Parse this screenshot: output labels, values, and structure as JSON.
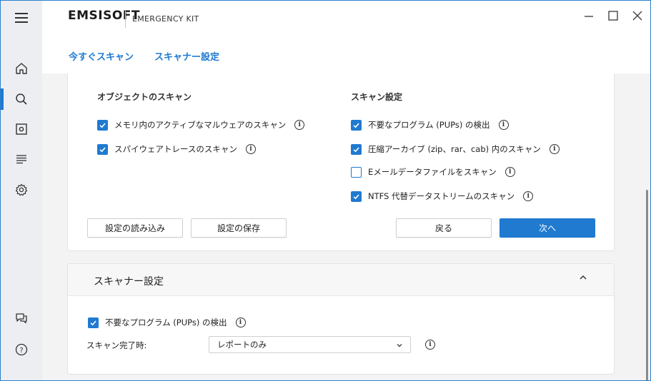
{
  "app": {
    "logo": "EMSISOFT",
    "product": "EMERGENCY KIT"
  },
  "window_controls": {
    "minimize_icon": "minimize-icon",
    "maximize_icon": "maximize-icon",
    "close_icon": "close-icon"
  },
  "sidebar": {
    "items": [
      {
        "icon": "home-icon"
      },
      {
        "icon": "search-icon",
        "active": true
      },
      {
        "icon": "quarantine-icon"
      },
      {
        "icon": "logs-icon"
      },
      {
        "icon": "settings-icon"
      },
      {
        "icon": "chat-icon"
      },
      {
        "icon": "help-icon"
      }
    ]
  },
  "tabs": {
    "scan_now": "今すぐスキャン",
    "scanner_settings": "スキャナー設定"
  },
  "objects_section": {
    "title": "オブジェクトのスキャン",
    "options": [
      {
        "label": "メモリ内のアクティブなマルウェアのスキャン",
        "checked": true
      },
      {
        "label": "スパイウェアトレースのスキャン",
        "checked": true
      }
    ]
  },
  "scan_settings_section": {
    "title": "スキャン設定",
    "options": [
      {
        "label": "不要なプログラム (PUPs) の検出",
        "checked": true
      },
      {
        "label": "圧縮アーカイブ (zip、rar、cab) 内のスキャン",
        "checked": true
      },
      {
        "label": "Eメールデータファイルをスキャン",
        "checked": false
      },
      {
        "label": "NTFS 代替データストリームのスキャン",
        "checked": true
      }
    ]
  },
  "buttons": {
    "load_settings": "設定の読み込み",
    "save_settings": "設定の保存",
    "back": "戻る",
    "next": "次へ"
  },
  "scanner_panel": {
    "title": "スキャナー設定",
    "pup_label": "不要なプログラム (PUPs) の検出",
    "pup_checked": true,
    "on_complete_label": "スキャン完了時:",
    "on_complete_value": "レポートのみ"
  },
  "colors": {
    "accent": "#1f7ad0",
    "window_border": "#2a7fcf"
  }
}
